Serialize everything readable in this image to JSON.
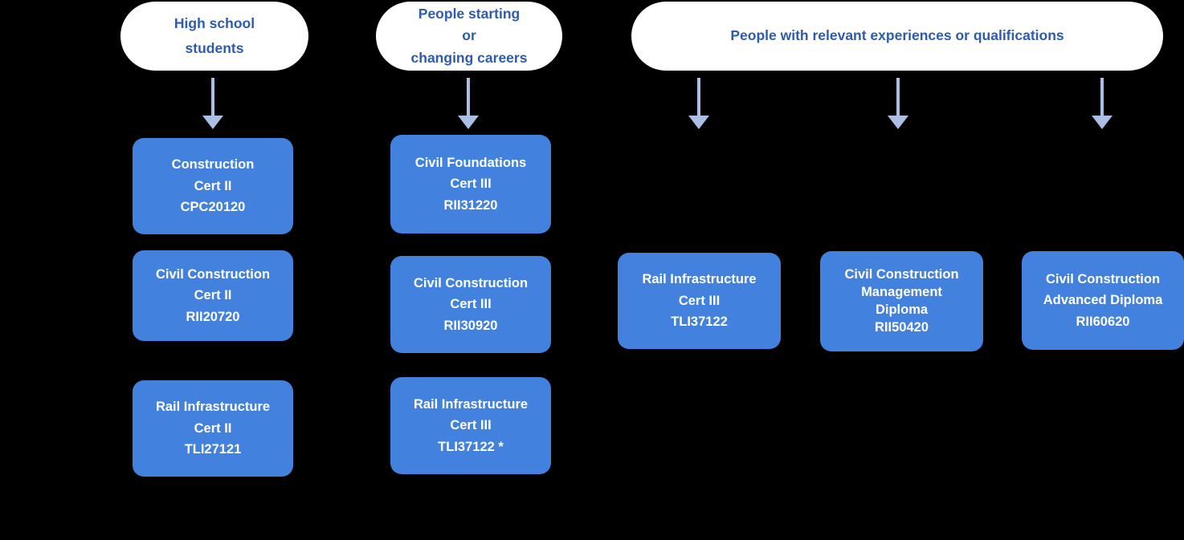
{
  "diagram": {
    "title_text_color": "#2d5cad",
    "box_fill_color": "#4281dd",
    "box_text_color": "#ffffff",
    "arrow_color": "#aabfe3",
    "background_color": "#000000"
  },
  "audiences": [
    {
      "id": "high-school-students",
      "lines": [
        "High school",
        "students"
      ],
      "text": "High school students"
    },
    {
      "id": "starting-or-changing-careers",
      "lines": [
        "People starting",
        "or",
        "changing careers"
      ],
      "text": "People starting or changing careers"
    },
    {
      "id": "relevant-experience-or-qualifications",
      "lines": [
        "People with relevant experiences or qualifications"
      ],
      "text": "People with relevant experiences or qualifications"
    }
  ],
  "qualifications": [
    {
      "id": "construction-cert-ii",
      "lines": [
        "Construction",
        "Cert II",
        "CPC20120"
      ],
      "name": "Construction",
      "level": "Cert II",
      "code": "CPC20120"
    },
    {
      "id": "civil-construction-cert-ii",
      "lines": [
        "Civil Construction",
        "Cert II",
        "RII20720"
      ],
      "name": "Civil Construction",
      "level": "Cert II",
      "code": "RII20720"
    },
    {
      "id": "rail-infrastructure-cert-ii",
      "lines": [
        "Rail Infrastructure",
        "Cert II",
        "TLI27121"
      ],
      "name": "Rail Infrastructure",
      "level": "Cert II",
      "code": "TLI27121"
    },
    {
      "id": "civil-foundations-cert-iii",
      "lines": [
        "Civil Foundations",
        "Cert III",
        "RII31220"
      ],
      "name": "Civil Foundations",
      "level": "Cert III",
      "code": "RII31220"
    },
    {
      "id": "civil-construction-cert-iii",
      "lines": [
        "Civil Construction",
        "Cert III",
        "RII30920"
      ],
      "name": "Civil Construction",
      "level": "Cert III",
      "code": "RII30920"
    },
    {
      "id": "rail-infrastructure-cert-iii-starred",
      "lines": [
        "Rail Infrastructure",
        "Cert III",
        "TLI37122 *"
      ],
      "name": "Rail Infrastructure",
      "level": "Cert III",
      "code": "TLI37122 *"
    },
    {
      "id": "rail-infrastructure-cert-iii",
      "lines": [
        "Rail Infrastructure",
        "Cert III",
        "TLI37122"
      ],
      "name": "Rail Infrastructure",
      "level": "Cert III",
      "code": "TLI37122"
    },
    {
      "id": "civil-construction-management-diploma",
      "lines": [
        "Civil Construction",
        "Management",
        "Diploma",
        "RII50420"
      ],
      "name": "Civil Construction Management",
      "level": "Diploma",
      "code": "RII50420"
    },
    {
      "id": "civil-construction-advanced-diploma",
      "lines": [
        "Civil Construction",
        "Advanced Diploma",
        "RII60620"
      ],
      "name": "Civil Construction",
      "level": "Advanced Diploma",
      "code": "RII60620"
    }
  ]
}
